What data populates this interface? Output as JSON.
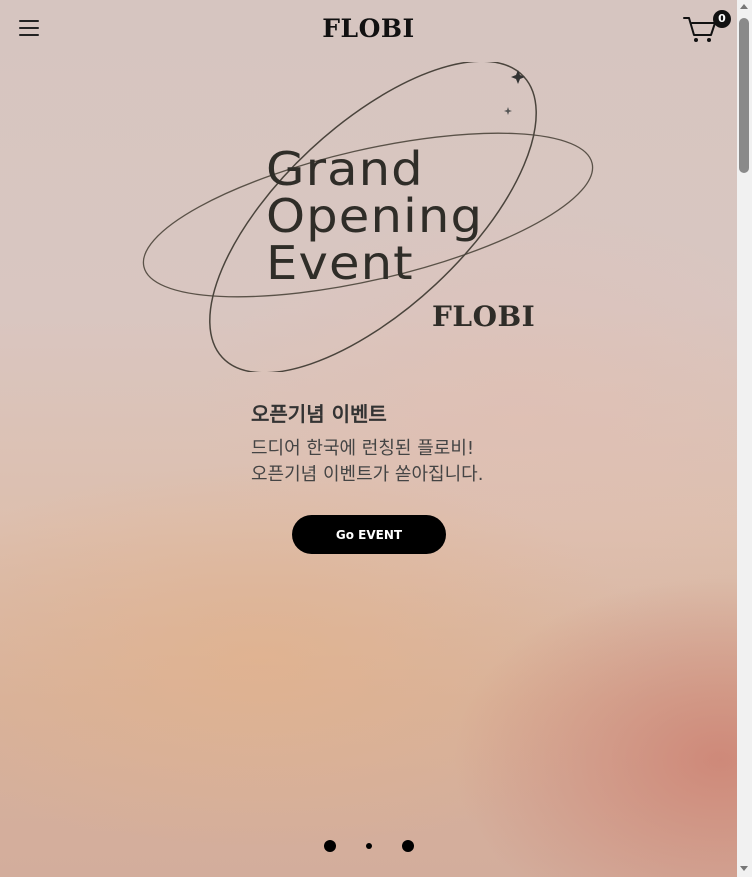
{
  "header": {
    "brand": "FLOBI",
    "menu_icon": "hamburger-menu-icon",
    "cart_icon": "shopping-cart-icon",
    "cart_count": "0"
  },
  "hero": {
    "title_lines": [
      "Grand",
      "Opening",
      "Event"
    ],
    "brand_mark": "FLOBI",
    "event_heading": "오픈기념 이벤트",
    "event_description_lines": [
      "드디어 한국에 런칭된 플로비!",
      "오픈기념 이벤트가 쏟아집니다."
    ],
    "cta_label": "Go EVENT"
  },
  "slider": {
    "total_slides": 3,
    "active_index": 1
  },
  "colors": {
    "title_text": "#2f2d28",
    "button_bg": "#000000",
    "button_text": "#ffffff"
  }
}
